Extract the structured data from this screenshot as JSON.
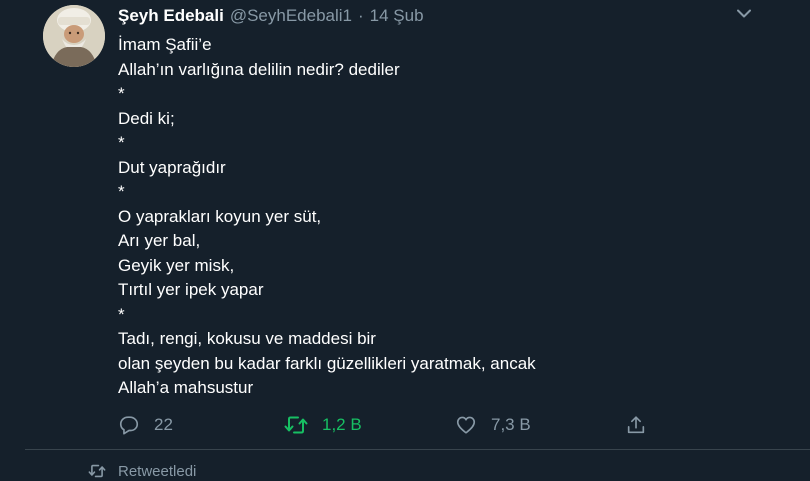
{
  "tweet": {
    "author_name": "Şeyh Edebali",
    "handle": "@SeyhEdebali1",
    "separator": "·",
    "date": "14 Şub",
    "lines": [
      "İmam Şafii’e",
      "Allah’ın varlığına delilin nedir? dediler",
      "*",
      "Dedi ki;",
      "*",
      "Dut yaprağıdır",
      "*",
      "O yaprakları koyun yer süt,",
      "Arı yer bal,",
      "Geyik yer misk,",
      "Tırtıl yer ipek yapar",
      "*",
      "Tadı, rengi, kokusu ve maddesi bir",
      "olan şeyden bu kadar farklı güzellikleri yaratmak, ancak",
      "Allah’a mahsustur"
    ],
    "actions": {
      "reply_count": "22",
      "retweet_count": "1,2 B",
      "like_count": "7,3 B"
    }
  },
  "next_item": {
    "retweeted_label": "Retweetledi"
  },
  "colors": {
    "background": "#15202b",
    "text": "#ffffff",
    "secondary_text": "#8899a6",
    "retweet_green": "#17bf63",
    "divider": "#38444d"
  },
  "icons": {
    "caret": "chevron-down-icon",
    "reply": "reply-icon",
    "retweet": "retweet-icon",
    "like": "heart-icon",
    "share": "share-icon"
  }
}
